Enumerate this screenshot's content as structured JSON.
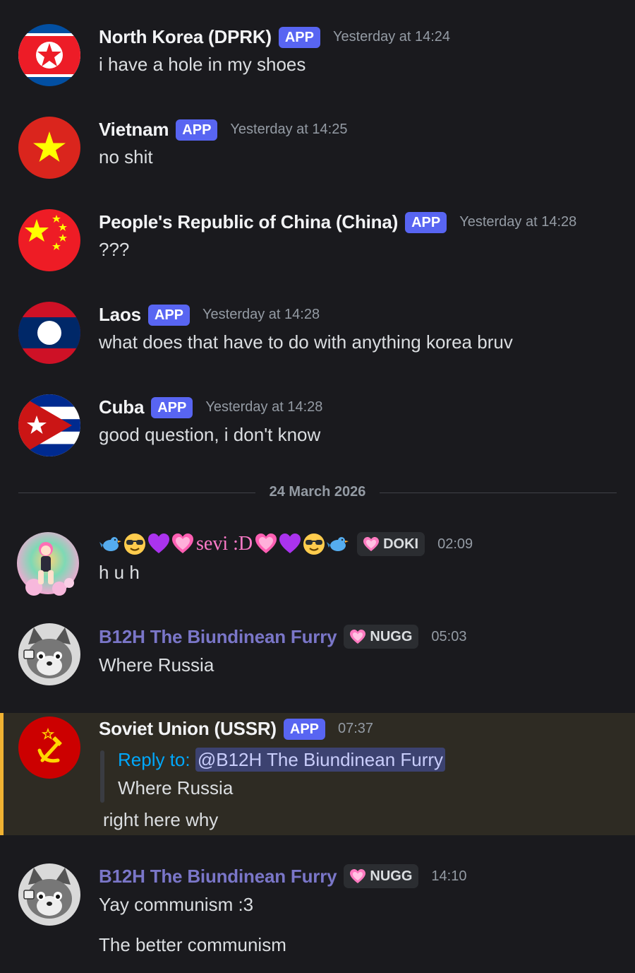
{
  "messages": [
    {
      "name": "North Korea (DPRK)",
      "badge": "APP",
      "time": "Yesterday at 14:24",
      "text": "i have a hole in my shoes",
      "avatar_icon": "north-korea-flag-icon"
    },
    {
      "name": "Vietnam",
      "badge": "APP",
      "time": "Yesterday at 14:25",
      "text": "no shit",
      "avatar_icon": "vietnam-flag-icon"
    },
    {
      "name": "People's Republic of China (China)",
      "badge": "APP",
      "time": "Yesterday at 14:28",
      "text": "???",
      "avatar_icon": "china-flag-icon"
    },
    {
      "name": "Laos",
      "badge": "APP",
      "time": "Yesterday at 14:28",
      "text": "what does that have to do with anything korea bruv",
      "avatar_icon": "laos-flag-icon"
    },
    {
      "name": "Cuba",
      "badge": "APP",
      "time": "Yesterday at 14:28",
      "text": "good question, i don't know",
      "avatar_icon": "cuba-flag-icon"
    }
  ],
  "divider": {
    "date": "24 March 2026"
  },
  "sevi": {
    "name_text": "sevi :D",
    "tag": "DOKI",
    "time": "02:09",
    "text": "h u h"
  },
  "b12h_1": {
    "name": "B12H The Biundinean Furry",
    "tag": "NUGG",
    "time": "05:03",
    "text": "Where Russia"
  },
  "ussr": {
    "name": "Soviet Union (USSR)",
    "badge": "APP",
    "time": "07:37",
    "reply_label": "Reply to:",
    "reply_mention": "@B12H The Biundinean Furry",
    "reply_text": "Where Russia",
    "text": "right here why"
  },
  "b12h_2": {
    "name": "B12H The Biundinean Furry",
    "tag": "NUGG",
    "time": "14:10",
    "text_1": "Yay communism :3",
    "text_2": "The better communism"
  },
  "colors": {
    "background": "#1a1a1e",
    "app_badge": "#5865f2",
    "highlight": "#2e2b23",
    "highlight_bar": "#f0b232",
    "reply": "#00a8fc",
    "role_name": "#7a76c8"
  }
}
